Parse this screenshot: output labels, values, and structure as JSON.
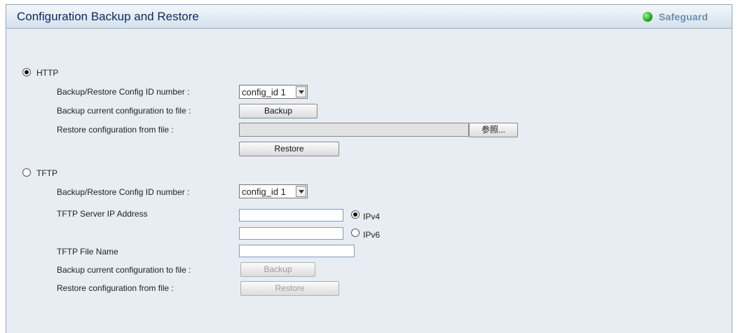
{
  "header": {
    "title": "Configuration Backup and Restore",
    "status_label": "Safeguard",
    "status_color": "#1ea51e"
  },
  "http": {
    "label": "HTTP",
    "selected": true,
    "config_id_label": "Backup/Restore Config ID number :",
    "config_id_value": "config_id 1",
    "backup_label": "Backup current configuration to file :",
    "backup_button": "Backup",
    "restore_label": "Restore configuration from file :",
    "browse_button": "参照...",
    "restore_button": "Restore"
  },
  "tftp": {
    "label": "TFTP",
    "selected": false,
    "config_id_label": "Backup/Restore Config ID number :",
    "config_id_value": "config_id 1",
    "server_ip_label": "TFTP Server IP Address",
    "ipv4_label": "IPv4",
    "ipv6_label": "IPv6",
    "ipv4_selected": true,
    "file_name_label": "TFTP File Name",
    "backup_label": "Backup current configuration to file :",
    "backup_button": "Backup",
    "restore_label": "Restore configuration from file :",
    "restore_button": "Restore"
  }
}
